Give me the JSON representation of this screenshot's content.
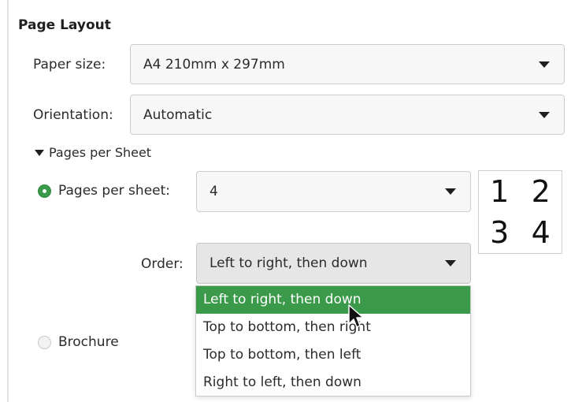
{
  "section": {
    "title": "Page Layout"
  },
  "paper_size": {
    "label": "Paper size:",
    "value": "A4 210mm x 297mm"
  },
  "orientation": {
    "label": "Orientation:",
    "value": "Automatic"
  },
  "pages_per_sheet_expander": {
    "label": "Pages per Sheet",
    "expanded": true
  },
  "pages_per_sheet": {
    "label": "Pages per sheet:",
    "value": "4",
    "selected": true
  },
  "preview": {
    "cells": [
      "1",
      "2",
      "3",
      "4"
    ]
  },
  "order": {
    "label": "Order:",
    "value": "Left to right, then down",
    "options": [
      "Left to right, then down",
      "Top to bottom, then right",
      "Top to bottom, then left",
      "Right to left, then down"
    ],
    "highlighted_index": 0
  },
  "brochure": {
    "label": "Brochure",
    "selected": false
  },
  "colors": {
    "accent": "#3b9a4a",
    "border": "#cdcdcd",
    "field_bg": "#f7f7f7"
  },
  "icons": [
    "chevron-down-icon",
    "expander-triangle-icon",
    "radio-icon",
    "mouse-cursor-icon"
  ]
}
